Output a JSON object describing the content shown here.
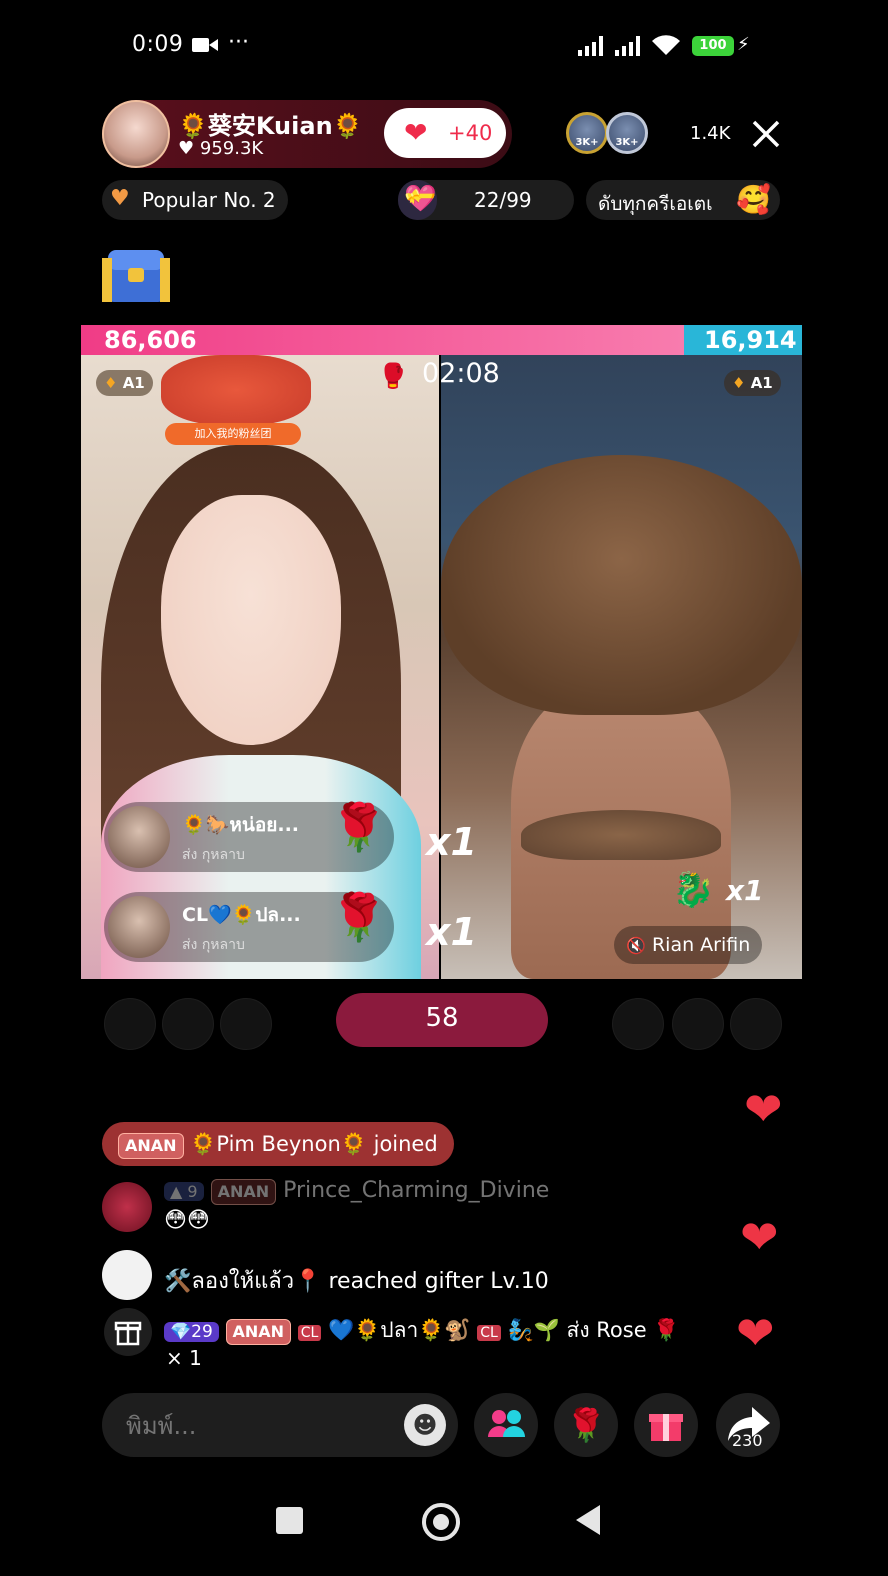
{
  "status_bar": {
    "time": "0:09",
    "battery": "100"
  },
  "host": {
    "name": "🌻葵安Kuian🌻",
    "likes": "959.3K",
    "like_plus": "+40"
  },
  "viewers": {
    "badge_1": "3K+",
    "badge_2": "3K+",
    "count": "1.4K"
  },
  "chips": {
    "popular": "Popular No. 2",
    "progress": "22/99",
    "progress_value": 0.222,
    "marquee": "ดับทุกครีเอเตเ"
  },
  "pk": {
    "left_score": "86,606",
    "right_score": "16,914",
    "left_share": 0.837,
    "timer": "02:08",
    "left_rank": "A1",
    "right_rank": "A1",
    "sticker_text": "加入我的粉丝团",
    "gifts_left": [
      {
        "name": "🌻🐎หน่อย...",
        "action": "ส่ง กุหลาบ",
        "count": "x1"
      },
      {
        "name": "CL💙🌻ปล...",
        "action": "ส่ง กุหลาบ",
        "count": "x1"
      }
    ],
    "right_gift_count": "x1",
    "right_streamer": "Rian Arifin",
    "center_score": "58"
  },
  "chat": {
    "joined": {
      "badge": "ANAN",
      "user": "🌻Pim Beynon🌻",
      "text": "joined"
    },
    "messages": [
      {
        "level": "9",
        "badge": "ANAN",
        "user": "Prince_Charming_Divine",
        "text": "😳😳"
      },
      {
        "user": "🛠️ลองให้แล้ว📍",
        "text": "reached gifter Lv.10"
      },
      {
        "level": "29",
        "badge": "ANAN",
        "tag": "CL",
        "user": "💙🌻ปลา🌻🐒",
        "tag2": "CL",
        "extra": "🧞🌱",
        "text": "ส่ง Rose 🌹",
        "count": "× 1"
      }
    ]
  },
  "composer": {
    "placeholder": "พิมพ์...",
    "share_count": "230"
  },
  "colors": {
    "pk_pink": "#f03c86",
    "pk_blue": "#29b6d8",
    "accent_red": "#ef2b4b",
    "score_pill": "#8b1a3d"
  },
  "icons": [
    "video-camera-icon",
    "wifi-icon",
    "close-icon",
    "heart-icon",
    "treasure-chest-icon",
    "rose-icon",
    "gift-icon",
    "multi-guest-icon",
    "share-icon",
    "smiley-icon",
    "mute-icon"
  ]
}
